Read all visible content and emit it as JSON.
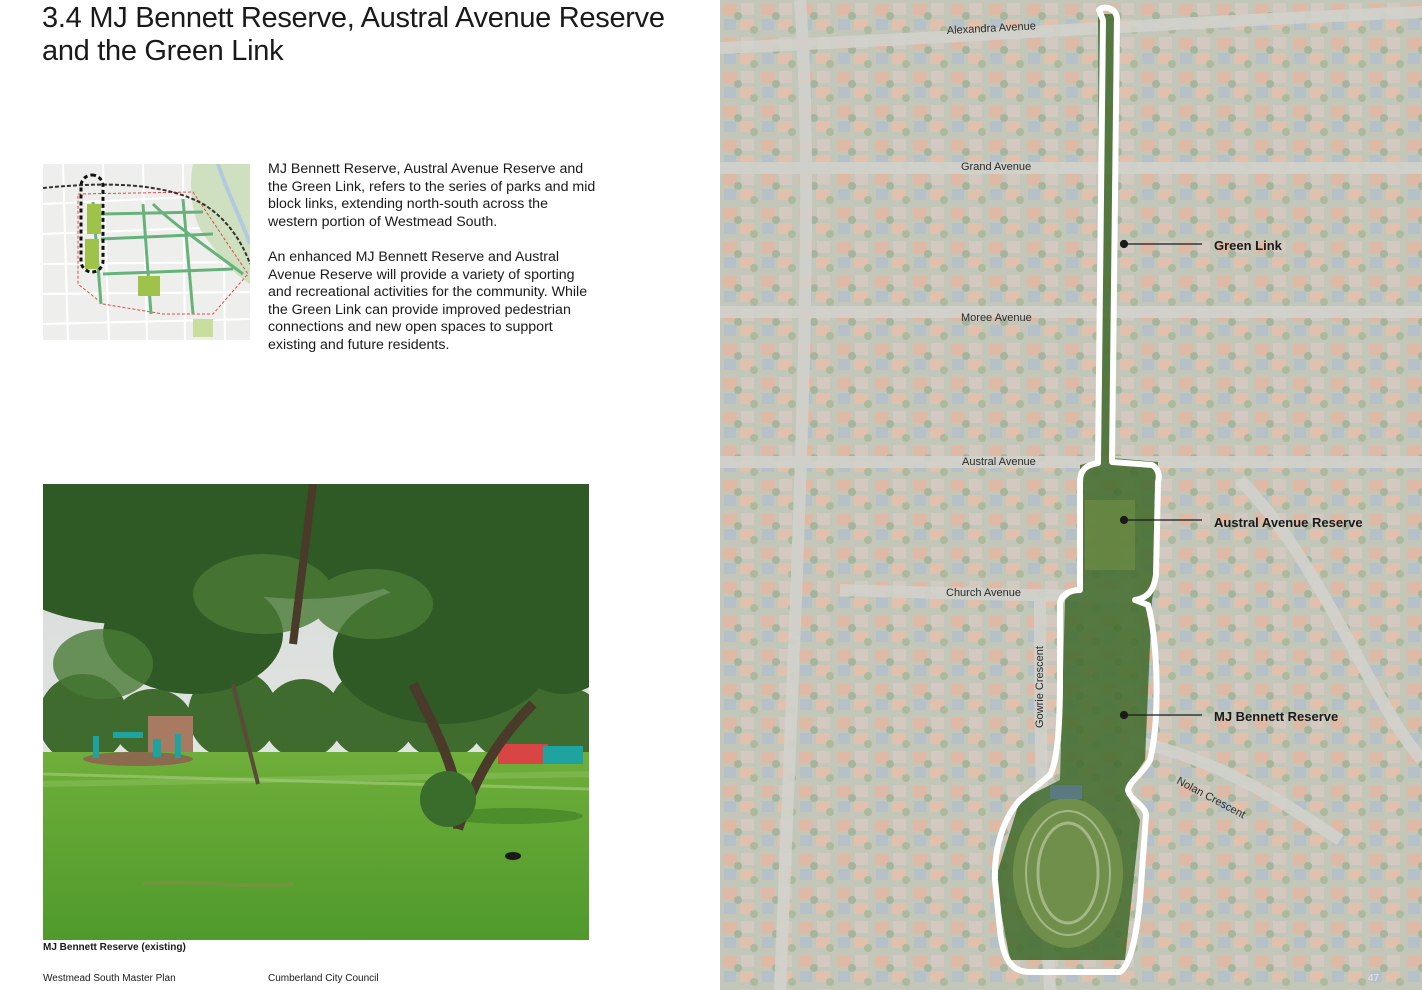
{
  "section": {
    "number": "3.4",
    "title": "MJ Bennett Reserve, Austral Avenue Reserve and the Green Link"
  },
  "body": {
    "paragraph_1": "MJ Bennett Reserve, Austral Avenue Reserve and the Green Link, refers to the series of parks and mid block links, extending north-south across the western portion of Westmead South.",
    "paragraph_2": "An enhanced MJ Bennett Reserve and Austral Avenue Reserve will provide a variety of sporting and recreational activities for the community. While the Green Link can provide improved pedestrian connections and new open spaces to support existing and future residents."
  },
  "photo": {
    "caption": "MJ Bennett Reserve (existing)"
  },
  "map": {
    "roads": {
      "alexandra": "Alexandra Avenue",
      "grand": "Grand Avenue",
      "moree": "Moree Avenue",
      "austral": "Austral Avenue",
      "church": "Church Avenue",
      "gowrie": "Gowrie Crescent",
      "nolan": "Nolan Crescent"
    },
    "callouts": {
      "green_link": "Green Link",
      "austral_reserve": "Austral Avenue Reserve",
      "mj_bennett": "MJ Bennett Reserve"
    }
  },
  "footer": {
    "left": "Westmead South Master Plan",
    "middle": "Cumberland City Council",
    "page_number": "47"
  },
  "colors": {
    "accent_outline": "#ffffff",
    "keymap_highlight": "#9fc34a",
    "keymap_link": "#66b27a"
  }
}
